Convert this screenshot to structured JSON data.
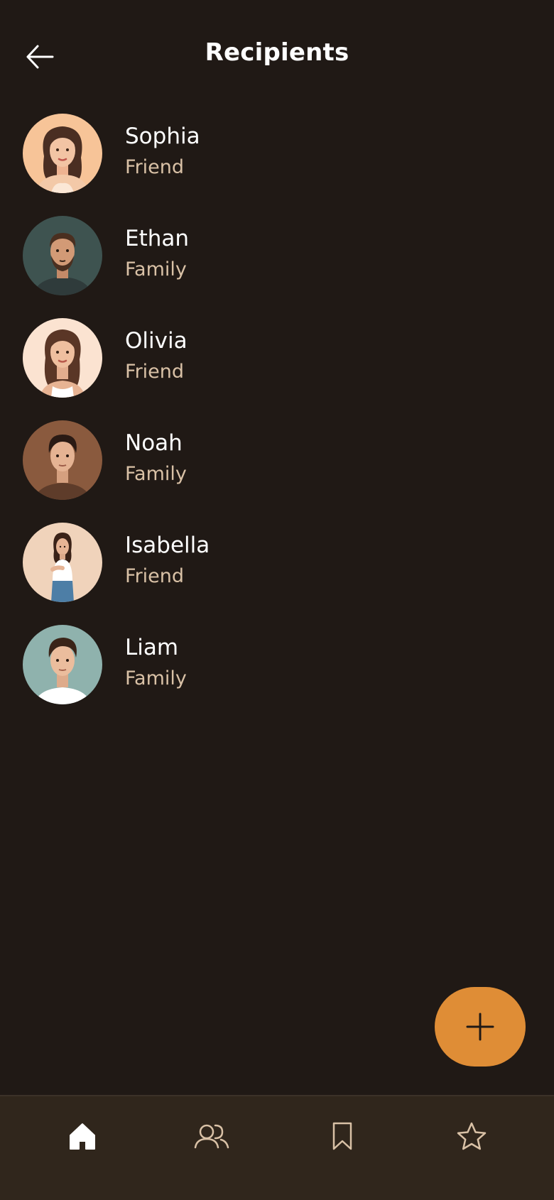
{
  "header": {
    "title": "Recipients",
    "back_icon": "arrow-left-icon"
  },
  "recipients": [
    {
      "name": "Sophia",
      "relation": "Friend"
    },
    {
      "name": "Ethan",
      "relation": "Family"
    },
    {
      "name": "Olivia",
      "relation": "Friend"
    },
    {
      "name": "Noah",
      "relation": "Family"
    },
    {
      "name": "Isabella",
      "relation": "Friend"
    },
    {
      "name": "Liam",
      "relation": "Family"
    }
  ],
  "fab": {
    "icon": "plus-icon"
  },
  "bottom_nav": {
    "items": [
      {
        "icon": "home-icon",
        "active": true
      },
      {
        "icon": "people-icon",
        "active": false
      },
      {
        "icon": "bookmark-icon",
        "active": false
      },
      {
        "icon": "star-icon",
        "active": false
      }
    ]
  },
  "colors": {
    "background": "#201915",
    "nav_background": "#30261c",
    "accent": "#df8d36",
    "secondary_text": "#d9c1a6"
  }
}
